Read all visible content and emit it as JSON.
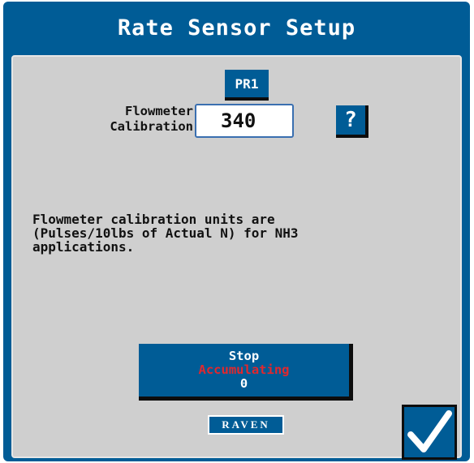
{
  "title": "Rate Sensor Setup",
  "product_tab": {
    "label": "PR1"
  },
  "calibration": {
    "label_line1": "Flowmeter",
    "label_line2": "Calibration",
    "value": "340"
  },
  "help_button": {
    "label": "?"
  },
  "info_text": "Flowmeter calibration units are\n(Pulses/10lbs of Actual N) for NH3\napplications.",
  "stop_button": {
    "line1": "Stop",
    "line2": "Accumulating",
    "line3": "0"
  },
  "brand": {
    "logo_text": "RAVEN"
  },
  "colors": {
    "frame_blue": "#005c96",
    "panel_gray": "#cfcfcf",
    "alert_red": "#e0282e"
  },
  "icons": {
    "confirm": "checkmark-icon",
    "help": "question-mark-icon"
  }
}
